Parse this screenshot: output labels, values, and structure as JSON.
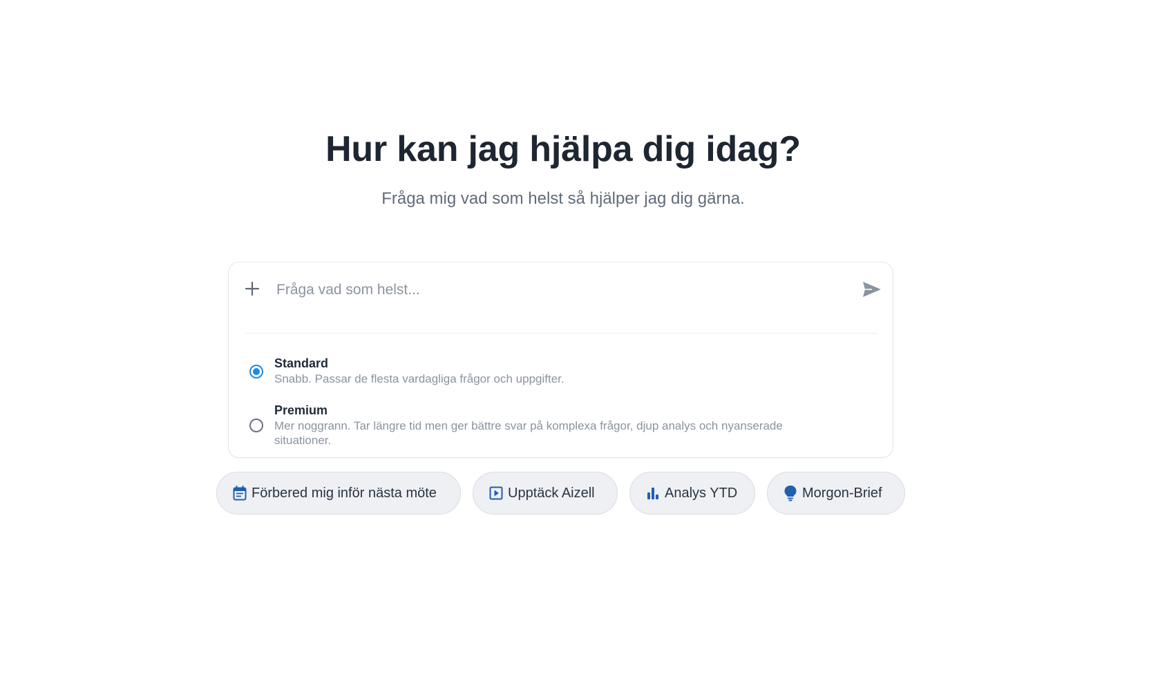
{
  "hero": {
    "title": "Hur kan jag hjälpa dig idag?",
    "subtitle": "Fråga mig vad som helst så hjälper jag dig gärna."
  },
  "composer": {
    "input_value": "",
    "input_placeholder": "Fråga vad som helst...",
    "add_icon": "plus-icon",
    "send_icon": "send-icon"
  },
  "modes": [
    {
      "name": "Standard",
      "description": "Snabb. Passar de flesta vardagliga frågor och uppgifter.",
      "selected": true
    },
    {
      "name": "Premium",
      "description": "Mer noggrann. Tar längre tid men ger bättre svar på komplexa frågor, djup analys och nyanserade situationer.",
      "selected": false
    }
  ],
  "suggestions": [
    {
      "label": "Förbered mig inför nästa möte",
      "icon": "calendar-icon"
    },
    {
      "label": "Upptäck Aizell",
      "icon": "play-icon"
    },
    {
      "label": "Analys YTD",
      "icon": "bar-chart-icon"
    },
    {
      "label": "Morgon-Brief",
      "icon": "lightbulb-icon"
    }
  ],
  "colors": {
    "accent": "#1d8ae6",
    "icon_blue": "#1f5fae",
    "title": "#1e2632",
    "muted": "#8a939f",
    "chip_bg": "#eef0f3"
  }
}
